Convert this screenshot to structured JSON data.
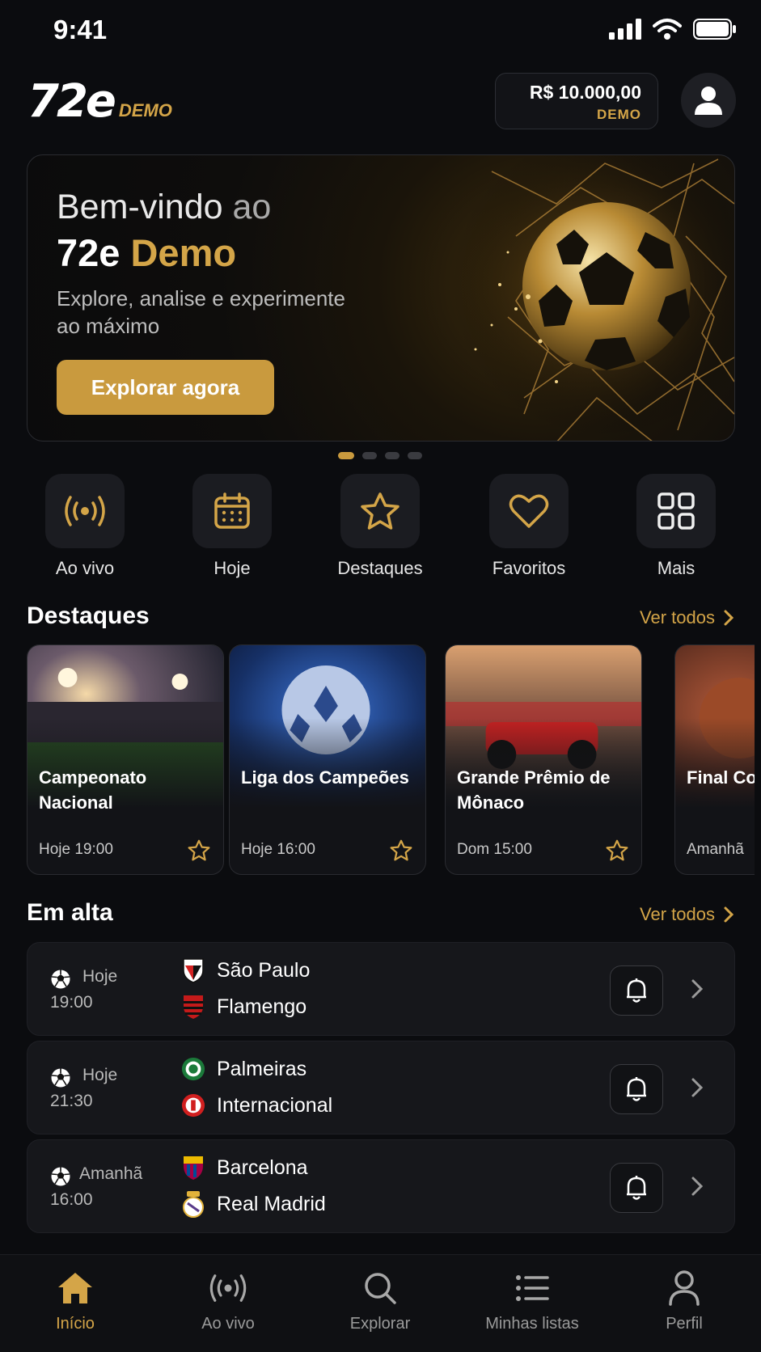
{
  "status_bar": {
    "time": "9:41"
  },
  "header": {
    "logo_text": "72e",
    "logo_badge": "DEMO",
    "balance_amount": "R$ 10.000,00",
    "balance_label": "DEMO"
  },
  "hero": {
    "title_line1_a": "Bem-vindo",
    "title_line1_b": " ao",
    "title_line2_a": "72e ",
    "title_line2_b": "Demo",
    "subtitle": "Explore, analise e experimente ao máximo",
    "cta_label": "Explorar agora",
    "slides_total": 4,
    "active_slide": 1
  },
  "quick_actions": [
    {
      "label": "Ao vivo",
      "icon": "live-broadcast-icon"
    },
    {
      "label": "Hoje",
      "icon": "calendar-icon"
    },
    {
      "label": "Destaques",
      "icon": "star-icon"
    },
    {
      "label": "Favoritos",
      "icon": "heart-icon"
    },
    {
      "label": "Mais",
      "icon": "grid-icon"
    }
  ],
  "highlights": {
    "title": "Destaques",
    "see_all": "Ver todos",
    "cards": [
      {
        "name": "Campeonato Nacional",
        "date": "Hoje 19:00"
      },
      {
        "name": "Liga dos Campeões",
        "date": "Hoje 16:00"
      },
      {
        "name": "Grande Prêmio de Mônaco",
        "date": "Dom 15:00"
      },
      {
        "name": "Final Conferê",
        "date": "Amanhã"
      }
    ]
  },
  "trending": {
    "title": "Em alta",
    "see_all": "Ver todos",
    "matches": [
      {
        "day": "Hoje",
        "time": "19:00",
        "home": "São Paulo",
        "away": "Flamengo"
      },
      {
        "day": "Hoje",
        "time": "21:30",
        "home": "Palmeiras",
        "away": "Internacional"
      },
      {
        "day": "Amanhã",
        "time": "16:00",
        "home": "Barcelona",
        "away": "Real Madrid"
      }
    ]
  },
  "bottom_nav": [
    {
      "label": "Início",
      "icon": "home-icon",
      "active": true
    },
    {
      "label": "Ao vivo",
      "icon": "live-broadcast-icon",
      "active": false
    },
    {
      "label": "Explorar",
      "icon": "search-icon",
      "active": false
    },
    {
      "label": "Minhas listas",
      "icon": "list-icon",
      "active": false
    },
    {
      "label": "Perfil",
      "icon": "user-icon",
      "active": false
    }
  ],
  "colors": {
    "accent": "#d4a548",
    "button": "#c99a3e",
    "background": "#0b0c0f",
    "surface": "#16171b"
  }
}
